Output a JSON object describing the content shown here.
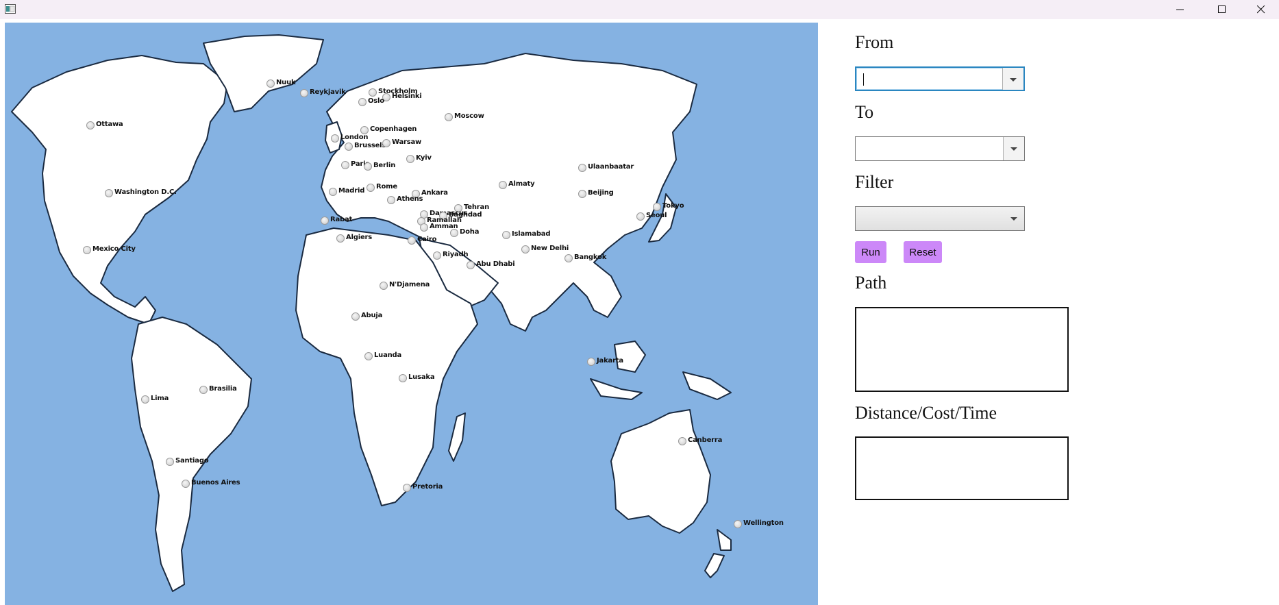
{
  "window": {
    "controls": {
      "minimize_icon": "minimize-icon",
      "maximize_icon": "maximize-icon",
      "close_icon": "close-icon"
    }
  },
  "map": {
    "background_color": "#85b2e2",
    "land_color": "#ffffff",
    "cities": [
      {
        "name": "Nuuk"
      },
      {
        "name": "Reykjavik"
      },
      {
        "name": "Stockholm"
      },
      {
        "name": "Helsinki"
      },
      {
        "name": "Oslo"
      },
      {
        "name": "Moscow"
      },
      {
        "name": "Copenhagen"
      },
      {
        "name": "London"
      },
      {
        "name": "Brussels"
      },
      {
        "name": "Warsaw"
      },
      {
        "name": "Kyiv"
      },
      {
        "name": "Paris"
      },
      {
        "name": "Berlin"
      },
      {
        "name": "Ulaanbaatar"
      },
      {
        "name": "Almaty"
      },
      {
        "name": "Madrid"
      },
      {
        "name": "Rome"
      },
      {
        "name": "Ankara"
      },
      {
        "name": "Athens"
      },
      {
        "name": "Beijing"
      },
      {
        "name": "Tokyo"
      },
      {
        "name": "Seoul"
      },
      {
        "name": "Tehran"
      },
      {
        "name": "Damascus"
      },
      {
        "name": "Baghdad"
      },
      {
        "name": "Ramallah"
      },
      {
        "name": "Amman"
      },
      {
        "name": "Rabat"
      },
      {
        "name": "Doha"
      },
      {
        "name": "Islamabad"
      },
      {
        "name": "Algiers"
      },
      {
        "name": "Cairo"
      },
      {
        "name": "New Delhi"
      },
      {
        "name": "Riyadh"
      },
      {
        "name": "Bangkok"
      },
      {
        "name": "Abu Dhabi"
      },
      {
        "name": "Ottawa"
      },
      {
        "name": "Washington D.C."
      },
      {
        "name": "Mexico City"
      },
      {
        "name": "N'Djamena"
      },
      {
        "name": "Abuja"
      },
      {
        "name": "Luanda"
      },
      {
        "name": "Jakarta"
      },
      {
        "name": "Lusaka"
      },
      {
        "name": "Brasilia"
      },
      {
        "name": "Lima"
      },
      {
        "name": "Canberra"
      },
      {
        "name": "Santiago"
      },
      {
        "name": "Buenos Aires"
      },
      {
        "name": "Pretoria"
      },
      {
        "name": "Wellington"
      }
    ]
  },
  "panel": {
    "from_label": "From",
    "from_value": "",
    "to_label": "To",
    "to_value": "",
    "filter_label": "Filter",
    "filter_value": "",
    "run_label": "Run",
    "reset_label": "Reset",
    "path_label": "Path",
    "path_output": "",
    "distance_label": "Distance/Cost/Time",
    "distance_output": "",
    "button_color": "#cc88f8",
    "focus_color": "#2a86c0"
  }
}
